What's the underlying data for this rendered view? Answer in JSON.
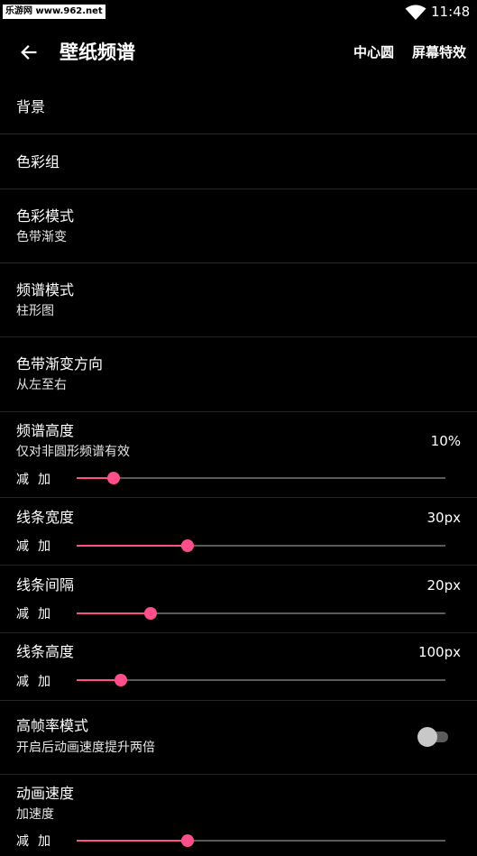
{
  "status_bar": {
    "watermark": "乐游网 www.962.net",
    "time": "11:48",
    "wifi_icon": "wifi-icon"
  },
  "app_bar": {
    "back_icon": "arrow-left-icon",
    "title": "壁纸频谱",
    "actions": [
      "中心圆",
      "屏幕特效"
    ]
  },
  "settings": {
    "background": {
      "title": "背景"
    },
    "color_group": {
      "title": "色彩组"
    },
    "color_mode": {
      "title": "色彩模式",
      "summary": "色带渐变"
    },
    "spectrum_mode": {
      "title": "频谱模式",
      "summary": "柱形图"
    },
    "gradient_direction": {
      "title": "色带渐变方向",
      "summary": "从左至右"
    },
    "spectrum_height": {
      "title": "频谱高度",
      "summary": "仅对非圆形频谱有效",
      "value": "10%",
      "decrease": "减",
      "increase": "加",
      "slider_fraction": 0.1
    },
    "line_width": {
      "title": "线条宽度",
      "value": "30px",
      "decrease": "减",
      "increase": "加",
      "slider_fraction": 0.3
    },
    "line_spacing": {
      "title": "线条间隔",
      "value": "20px",
      "decrease": "减",
      "increase": "加",
      "slider_fraction": 0.2
    },
    "line_height": {
      "title": "线条高度",
      "value": "100px",
      "decrease": "减",
      "increase": "加",
      "slider_fraction": 0.12
    },
    "high_frame_rate": {
      "title": "高帧率模式",
      "summary": "开启后动画速度提升两倍",
      "enabled": false
    },
    "animation_speed": {
      "title": "动画速度",
      "summary": "加速度",
      "decrease": "减",
      "increase": "加",
      "slider_fraction": 0.3
    }
  },
  "colors": {
    "accent": "#ff4f8b",
    "background": "#000000",
    "divider": "#242424",
    "track": "#5a5a5a"
  }
}
